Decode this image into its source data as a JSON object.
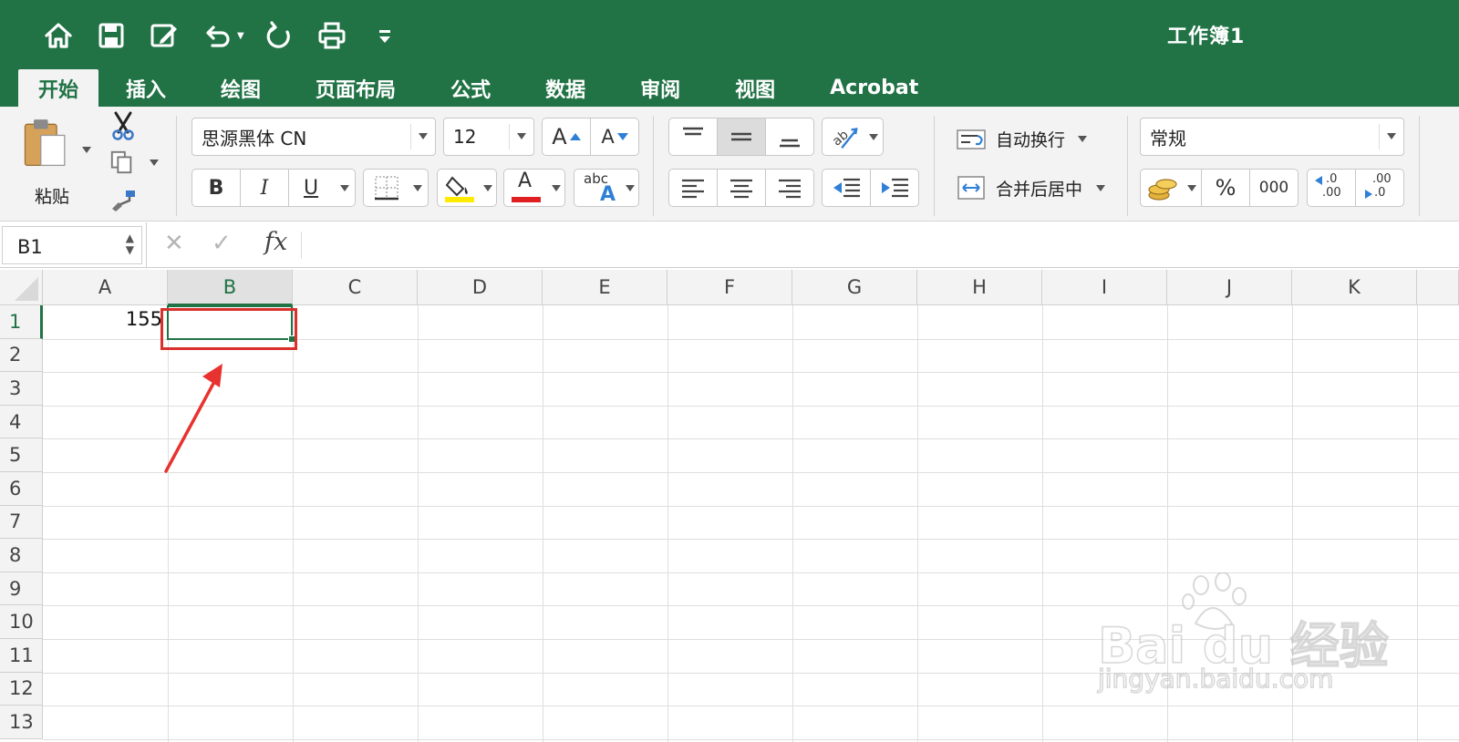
{
  "app": {
    "title": "工作簿1",
    "colors": {
      "accent": "#217346",
      "annotation": "#d9302c",
      "fill_highlight": "#ffeb00",
      "font_color_bar": "#e02020"
    }
  },
  "quick_access": [
    "home-icon",
    "save-icon",
    "edit-icon",
    "undo-icon",
    "redo-icon",
    "print-icon",
    "customize-icon"
  ],
  "tabs": [
    {
      "label": "开始",
      "active": true
    },
    {
      "label": "插入"
    },
    {
      "label": "绘图"
    },
    {
      "label": "页面布局"
    },
    {
      "label": "公式"
    },
    {
      "label": "数据"
    },
    {
      "label": "审阅"
    },
    {
      "label": "视图"
    },
    {
      "label": "Acrobat"
    }
  ],
  "ribbon": {
    "paste_label": "粘贴",
    "font_name": "思源黑体 CN",
    "font_size": "12",
    "grow_font": "A",
    "shrink_font": "A",
    "bold": "B",
    "italic": "I",
    "underline": "U",
    "font_color_letter": "A",
    "abc_label": "abc",
    "abc_letter": "A",
    "wrap_text": "自动换行",
    "merge_center": "合并后居中",
    "number_format": "常规",
    "percent": "%",
    "thousands": "000",
    "inc_decimal_top": ".0",
    "inc_decimal_bottom": ".00",
    "dec_decimal_top": ".00",
    "dec_decimal_bottom": ".0"
  },
  "formula_bar": {
    "name_box": "B1",
    "cancel": "✕",
    "enter": "✓",
    "fx": "fx",
    "content": ""
  },
  "sheet": {
    "columns": [
      "A",
      "B",
      "C",
      "D",
      "E",
      "F",
      "G",
      "H",
      "I",
      "J",
      "K"
    ],
    "rows": [
      "1",
      "2",
      "3",
      "4",
      "5",
      "6",
      "7",
      "8",
      "9",
      "10",
      "11",
      "12",
      "13"
    ],
    "selected_cell": "B1",
    "cells": {
      "A1": "155"
    }
  },
  "watermark": {
    "brand": "Bai du 经验",
    "url": "jingyan.baidu.com"
  }
}
